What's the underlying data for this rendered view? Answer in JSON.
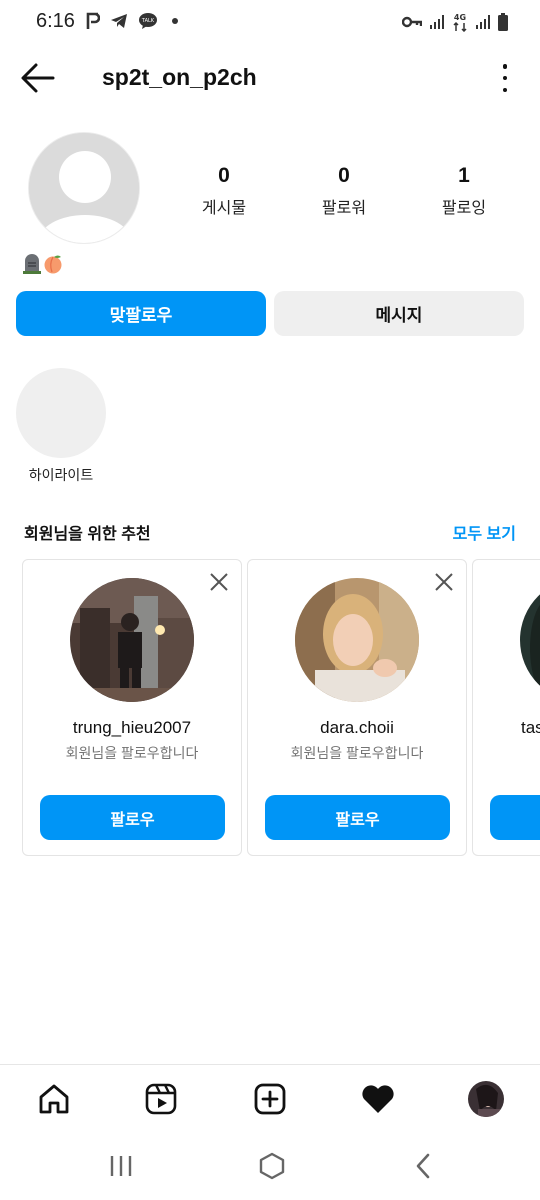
{
  "status_bar": {
    "time": "6:16",
    "network_label": "4G"
  },
  "header": {
    "username": "sp2t_on_p2ch",
    "back_icon": "arrow-left-icon",
    "more_icon": "more-vertical-icon"
  },
  "profile": {
    "stats": [
      {
        "value": "0",
        "label": "게시물"
      },
      {
        "value": "0",
        "label": "팔로워"
      },
      {
        "value": "1",
        "label": "팔로잉"
      }
    ],
    "bio_emojis": [
      "headstone-emoji",
      "peach-emoji"
    ]
  },
  "actions": {
    "follow_back_label": "맞팔로우",
    "message_label": "메시지"
  },
  "highlight": {
    "label": "하이라이트"
  },
  "suggestions": {
    "title": "회원님을 위한 추천",
    "see_all_label": "모두 보기",
    "cards": [
      {
        "username": "trung_hieu2007",
        "subtitle": "회원님을 팔로우합니다",
        "follow_label": "팔로우"
      },
      {
        "username": "dara.choii",
        "subtitle": "회원님을 팔로우합니다",
        "follow_label": "팔로우"
      },
      {
        "username": "tas",
        "subtitle": "",
        "follow_label": ""
      }
    ]
  },
  "bottom_nav": {
    "items": [
      "home-icon",
      "reels-icon",
      "create-icon",
      "activity-heart-icon",
      "profile-avatar"
    ]
  },
  "colors": {
    "accent": "#0095f6",
    "secondary_button": "#efefef",
    "muted_text": "#737373"
  }
}
